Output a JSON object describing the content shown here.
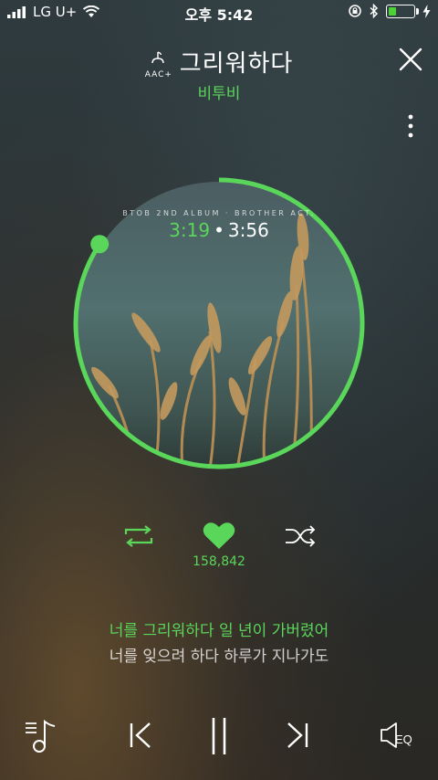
{
  "status": {
    "carrier": "LG U+",
    "time": "오후 5:42",
    "battery_level": 0.35,
    "icons": [
      "signal-icon",
      "wifi-icon",
      "orientation-lock-icon",
      "bluetooth-icon",
      "battery-icon",
      "charging-icon"
    ]
  },
  "header": {
    "audio_format": "AAC+",
    "song_title": "그리워하다",
    "artist": "비투비"
  },
  "player": {
    "album_label": "BTOB 2ND ALBUM · BROTHER ACT.",
    "current_time": "3:19",
    "separator": "•",
    "total_time": "3:56",
    "progress": 0.8432,
    "accent_color": "#5ad65a"
  },
  "actions": {
    "like_count": "158,842"
  },
  "lyrics": {
    "current_line": "너를 그리워하다 일 년이 가버렸어",
    "next_line": "너를 잊으려 하다 하루가 지나가도"
  },
  "controls": {
    "eq_label": "EQ"
  }
}
